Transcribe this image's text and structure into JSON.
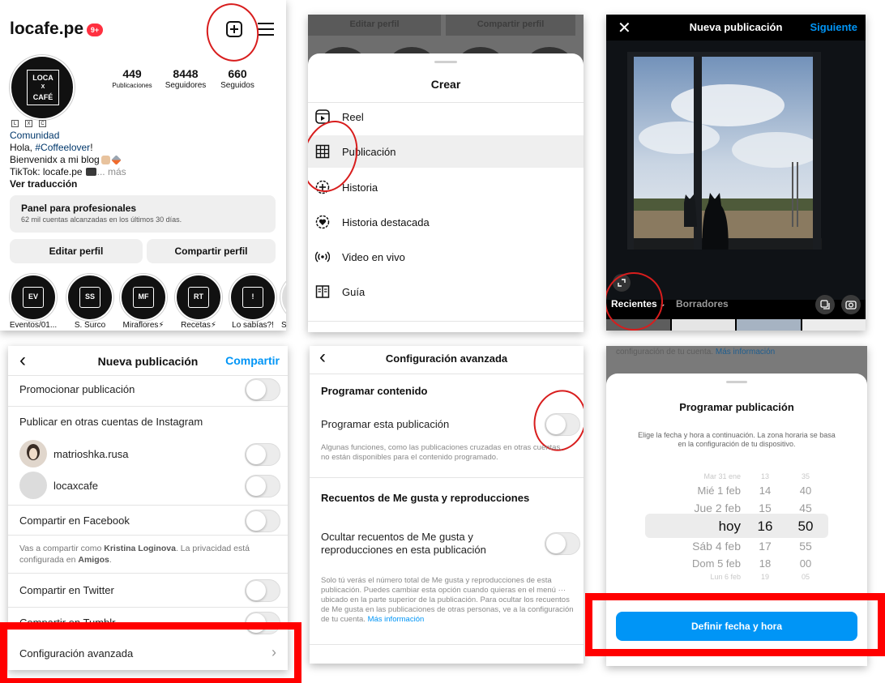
{
  "profile": {
    "username": "locafe.pe",
    "notif_badge": "9+",
    "logo_lines": [
      "LOCA",
      "X",
      "CAFÉ"
    ],
    "stats": [
      {
        "value": "449",
        "label": "Publicaciones"
      },
      {
        "value": "8448",
        "label": "Seguidores"
      },
      {
        "value": "660",
        "label": "Seguidos"
      }
    ],
    "bio_boxes": [
      "L",
      "X",
      "C"
    ],
    "category": "Comunidad",
    "bio_line1_prefix": "Hola, ",
    "bio_line1_hashtag": "#Coffeelover",
    "bio_line1_suffix": "!",
    "bio_line2": "Bienvenidx a mi blog",
    "bio_line3": "TikTok: locafe.pe",
    "bio_more": "... más",
    "translation": "Ver traducción",
    "pro_panel_title": "Panel para profesionales",
    "pro_panel_sub": "62 mil cuentas alcanzadas en los últimos 30 días.",
    "edit_button": "Editar perfil",
    "share_button": "Compartir perfil",
    "highlights": [
      {
        "badge": "EV",
        "label": "Eventos/01..."
      },
      {
        "badge": "SS",
        "label": "S. Surco"
      },
      {
        "badge": "MF",
        "label": "Miraflores⚡"
      },
      {
        "badge": "RT",
        "label": "Recetas⚡"
      },
      {
        "badge": "!",
        "label": "Lo sabías?!"
      },
      {
        "badge": "",
        "label": "S"
      }
    ]
  },
  "create_menu": {
    "bg_edit": "Editar perfil",
    "bg_share": "Compartir perfil",
    "title": "Crear",
    "items": [
      {
        "label": "Reel",
        "icon": "reel-icon"
      },
      {
        "label": "Publicación",
        "icon": "grid-icon"
      },
      {
        "label": "Historia",
        "icon": "story-add-icon"
      },
      {
        "label": "Historia destacada",
        "icon": "highlight-heart-icon"
      },
      {
        "label": "Video en vivo",
        "icon": "live-icon"
      },
      {
        "label": "Guía",
        "icon": "guide-icon"
      }
    ]
  },
  "new_post": {
    "close": "✕",
    "title": "Nueva publicación",
    "next": "Siguiente",
    "tab_recent": "Recientes",
    "tab_drafts": "Borradores"
  },
  "post_options": {
    "title": "Nueva publicación",
    "share": "Compartir",
    "promote": "Promocionar publicación",
    "other_accounts": "Publicar en otras cuentas de Instagram",
    "account1": "matrioshka.rusa",
    "account2": "locaxcafe",
    "facebook": "Compartir en Facebook",
    "fb_note_prefix": "Vas a compartir como ",
    "fb_name": "Kristina Loginova",
    "fb_note_mid": ". La privacidad está configurada en ",
    "fb_privacy": "Amigos",
    "fb_note_end": ".",
    "twitter": "Compartir en Twitter",
    "tumblr": "Compartir en Tumblr",
    "advanced": "Configuración avanzada"
  },
  "advanced": {
    "title": "Configuración avanzada",
    "schedule_header": "Programar contenido",
    "schedule_label": "Programar esta publicación",
    "schedule_note": "Algunas funciones, como las publicaciones cruzadas en otras cuentas, no están disponibles para el contenido programado.",
    "likes_header": "Recuentos de Me gusta y reproducciones",
    "likes_label": "Ocultar recuentos de Me gusta y reproducciones en esta publicación",
    "likes_note": "Solo tú verás el número total de Me gusta y reproducciones de esta publicación. Puedes cambiar esta opción cuando quieras en el menú ··· ubicado en la parte superior de la publicación. Para ocultar los recuentos de Me gusta en las publicaciones de otras personas, ve a la configuración de tu cuenta.",
    "more_info": "Más información"
  },
  "schedule": {
    "top_text": "configuración de tu cuenta.",
    "top_link": "Más información",
    "title": "Programar publicación",
    "desc": "Elige la fecha y hora a continuación. La zona horaria se basa en la configuración de tu dispositivo.",
    "rows": [
      {
        "day": "Mar 31 ene",
        "hour": "13",
        "min": "35"
      },
      {
        "day": "Mié 1 feb",
        "hour": "14",
        "min": "40"
      },
      {
        "day": "Jue 2 feb",
        "hour": "15",
        "min": "45"
      },
      {
        "day": "hoy",
        "hour": "16",
        "min": "50"
      },
      {
        "day": "Sáb 4 feb",
        "hour": "17",
        "min": "55"
      },
      {
        "day": "Dom 5 feb",
        "hour": "18",
        "min": "00"
      },
      {
        "day": "Lun 6 feb",
        "hour": "19",
        "min": "05"
      }
    ],
    "button": "Definir fecha y hora"
  },
  "colors": {
    "ig_blue": "#0095f6",
    "link": "#00376b",
    "annotation_red": "#ff0000",
    "badge_red": "#ff3040"
  }
}
